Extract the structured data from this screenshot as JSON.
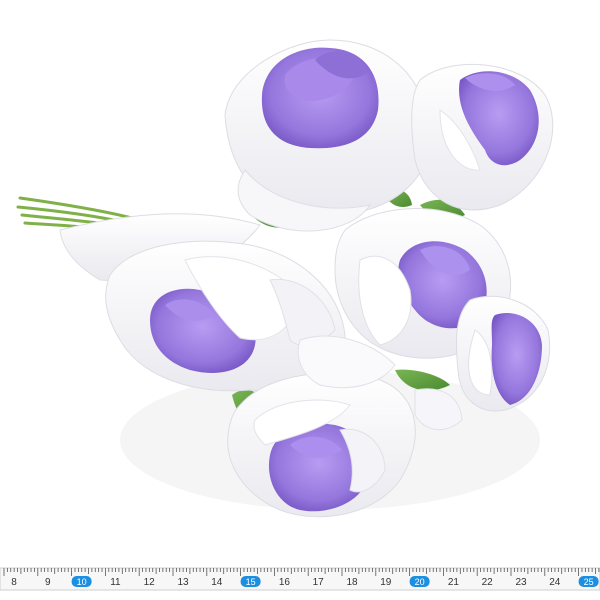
{
  "scene": {
    "subject": "bouquet of foam roses",
    "petal_colors": {
      "white": "#ffffff",
      "lavender": "#9c7fe0",
      "lavender_dark": "#7a5bc9",
      "leaf": "#5e9b3e",
      "stem": "#7ab04a"
    }
  },
  "ruler": {
    "labels": [
      "8",
      "9",
      "10",
      "11",
      "12",
      "13",
      "14",
      "15",
      "16",
      "17",
      "18",
      "19",
      "20",
      "21",
      "22",
      "23",
      "24",
      "25"
    ],
    "highlighted": [
      "10",
      "15",
      "20",
      "25"
    ],
    "highlight_color": "#1d8fe0"
  }
}
